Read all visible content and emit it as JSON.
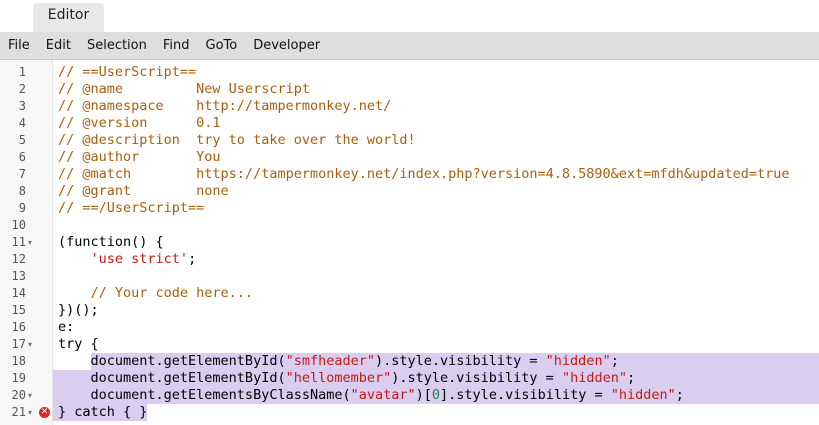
{
  "tab": {
    "label": "Editor"
  },
  "menu": [
    "File",
    "Edit",
    "Selection",
    "Find",
    "GoTo",
    "Developer"
  ],
  "error_marker": {
    "icon": "error-circle-icon",
    "color": "#d9262b",
    "glyph": "✕"
  },
  "colors": {
    "comment": "#a85f10",
    "string": "#c41a16",
    "number": "#1c7c54",
    "selection": "#d9cdf0"
  },
  "lines": [
    {
      "n": "1",
      "tokens": [
        {
          "t": "// ==UserScript==",
          "c": "comment"
        }
      ]
    },
    {
      "n": "2",
      "tokens": [
        {
          "t": "// @name         New Userscript",
          "c": "comment"
        }
      ]
    },
    {
      "n": "3",
      "tokens": [
        {
          "t": "// @namespace    http://tampermonkey.net/",
          "c": "comment"
        }
      ]
    },
    {
      "n": "4",
      "tokens": [
        {
          "t": "// @version      0.1",
          "c": "comment"
        }
      ]
    },
    {
      "n": "5",
      "tokens": [
        {
          "t": "// @description  try to take over the world!",
          "c": "comment"
        }
      ]
    },
    {
      "n": "6",
      "tokens": [
        {
          "t": "// @author       You",
          "c": "comment"
        }
      ]
    },
    {
      "n": "7",
      "tokens": [
        {
          "t": "// @match        https://tampermonkey.net/index.php?version=4.8.5890&ext=mfdh&updated=true",
          "c": "comment"
        }
      ]
    },
    {
      "n": "8",
      "tokens": [
        {
          "t": "// @grant        none",
          "c": "comment"
        }
      ]
    },
    {
      "n": "9",
      "tokens": [
        {
          "t": "// ==/UserScript==",
          "c": "comment"
        }
      ]
    },
    {
      "n": "10",
      "tokens": []
    },
    {
      "n": "11",
      "fold": "▾",
      "tokens": [
        {
          "t": "(function() {",
          "c": "plain"
        }
      ]
    },
    {
      "n": "12",
      "tokens": [
        {
          "t": "    ",
          "c": "plain"
        },
        {
          "t": "'use strict'",
          "c": "string"
        },
        {
          "t": ";",
          "c": "plain"
        }
      ]
    },
    {
      "n": "13",
      "tokens": []
    },
    {
      "n": "14",
      "tokens": [
        {
          "t": "    ",
          "c": "plain"
        },
        {
          "t": "// Your code here...",
          "c": "comment"
        }
      ]
    },
    {
      "n": "15",
      "tokens": [
        {
          "t": "})();",
          "c": "plain"
        }
      ]
    },
    {
      "n": "16",
      "tokens": [
        {
          "t": "e:",
          "c": "plain"
        }
      ]
    },
    {
      "n": "17",
      "fold": "▾",
      "tokens": [
        {
          "t": "try {",
          "c": "plain"
        }
      ]
    },
    {
      "n": "18",
      "sel": "indent",
      "tokens": [
        {
          "t": "    document.getElementById(",
          "c": "plain"
        },
        {
          "t": "\"smfheader\"",
          "c": "string"
        },
        {
          "t": ").style.visibility = ",
          "c": "plain"
        },
        {
          "t": "\"hidden\"",
          "c": "string"
        },
        {
          "t": ";",
          "c": "plain"
        }
      ]
    },
    {
      "n": "19",
      "sel": "full",
      "tokens": [
        {
          "t": "    document.getElementById(",
          "c": "plain"
        },
        {
          "t": "\"hellomember\"",
          "c": "string"
        },
        {
          "t": ").style.visibility = ",
          "c": "plain"
        },
        {
          "t": "\"hidden\"",
          "c": "string"
        },
        {
          "t": ";",
          "c": "plain"
        }
      ]
    },
    {
      "n": "20",
      "fold": "▾",
      "sel": "full",
      "tokens": [
        {
          "t": "    document.getElementsByClassName(",
          "c": "plain"
        },
        {
          "t": "\"avatar\"",
          "c": "string"
        },
        {
          "t": ")[",
          "c": "plain"
        },
        {
          "t": "0",
          "c": "number"
        },
        {
          "t": "].style.visibility = ",
          "c": "plain"
        },
        {
          "t": "\"hidden\"",
          "c": "string"
        },
        {
          "t": ";",
          "c": "plain"
        }
      ]
    },
    {
      "n": "21",
      "fold": "▾",
      "error": true,
      "sel": "partial",
      "tokens": [
        {
          "t": "} catch { }",
          "c": "plain"
        }
      ]
    }
  ]
}
